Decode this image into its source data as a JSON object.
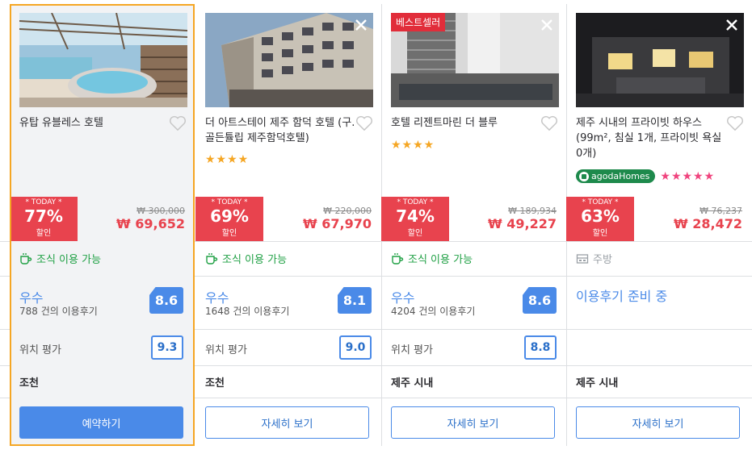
{
  "cards": [
    {
      "name": "유탑 유블레스 호텔",
      "stars": "",
      "today_label": "* TODAY *",
      "discount_pct": "77%",
      "discount_label": "할인",
      "original_price": "₩ 300,000",
      "price": "₩ 69,652",
      "perk": "조식 이용 가능",
      "rating_word": "우수",
      "review_count": "788 건의 이용후기",
      "score": "8.6",
      "location_label": "위치 평가",
      "location_score": "9.3",
      "area": "조천",
      "button": "예약하기"
    },
    {
      "name": "더 아트스테이 제주 함덕 호텔 (구. 골든튤립 제주함덕호텔)",
      "stars": "★★★★",
      "today_label": "* TODAY *",
      "discount_pct": "69%",
      "discount_label": "할인",
      "original_price": "₩ 220,000",
      "price": "₩ 67,970",
      "perk": "조식 이용 가능",
      "rating_word": "우수",
      "review_count": "1648 건의 이용후기",
      "score": "8.1",
      "location_label": "위치 평가",
      "location_score": "9.0",
      "area": "조천",
      "button": "자세히 보기"
    },
    {
      "name": "호텔 리젠트마린 더 블루",
      "stars": "★★★★",
      "badge": "베스트셀러",
      "today_label": "* TODAY *",
      "discount_pct": "74%",
      "discount_label": "할인",
      "original_price": "₩ 189,934",
      "price": "₩ 49,227",
      "perk": "조식 이용 가능",
      "rating_word": "우수",
      "review_count": "4204 건의 이용후기",
      "score": "8.6",
      "location_label": "위치 평가",
      "location_score": "8.8",
      "area": "제주 시내",
      "button": "자세히 보기"
    },
    {
      "name": "제주 시내의 프라이빗 하우스 (99m², 침실 1개, 프라이빗 욕실 0개)",
      "agoda_label": "agodaHomes",
      "pink_stars": "★★★★★",
      "today_label": "* TODAY *",
      "discount_pct": "63%",
      "discount_label": "할인",
      "original_price": "₩ 76,237",
      "price": "₩ 28,472",
      "perk": "주방",
      "pending": "이용후기 준비 중",
      "area": "제주 시내",
      "button": "자세히 보기"
    }
  ],
  "colors": {
    "accent": "#4a8ae8",
    "deal": "#e8434e",
    "selected_border": "#f5a623",
    "perk_green": "#1fa044"
  }
}
